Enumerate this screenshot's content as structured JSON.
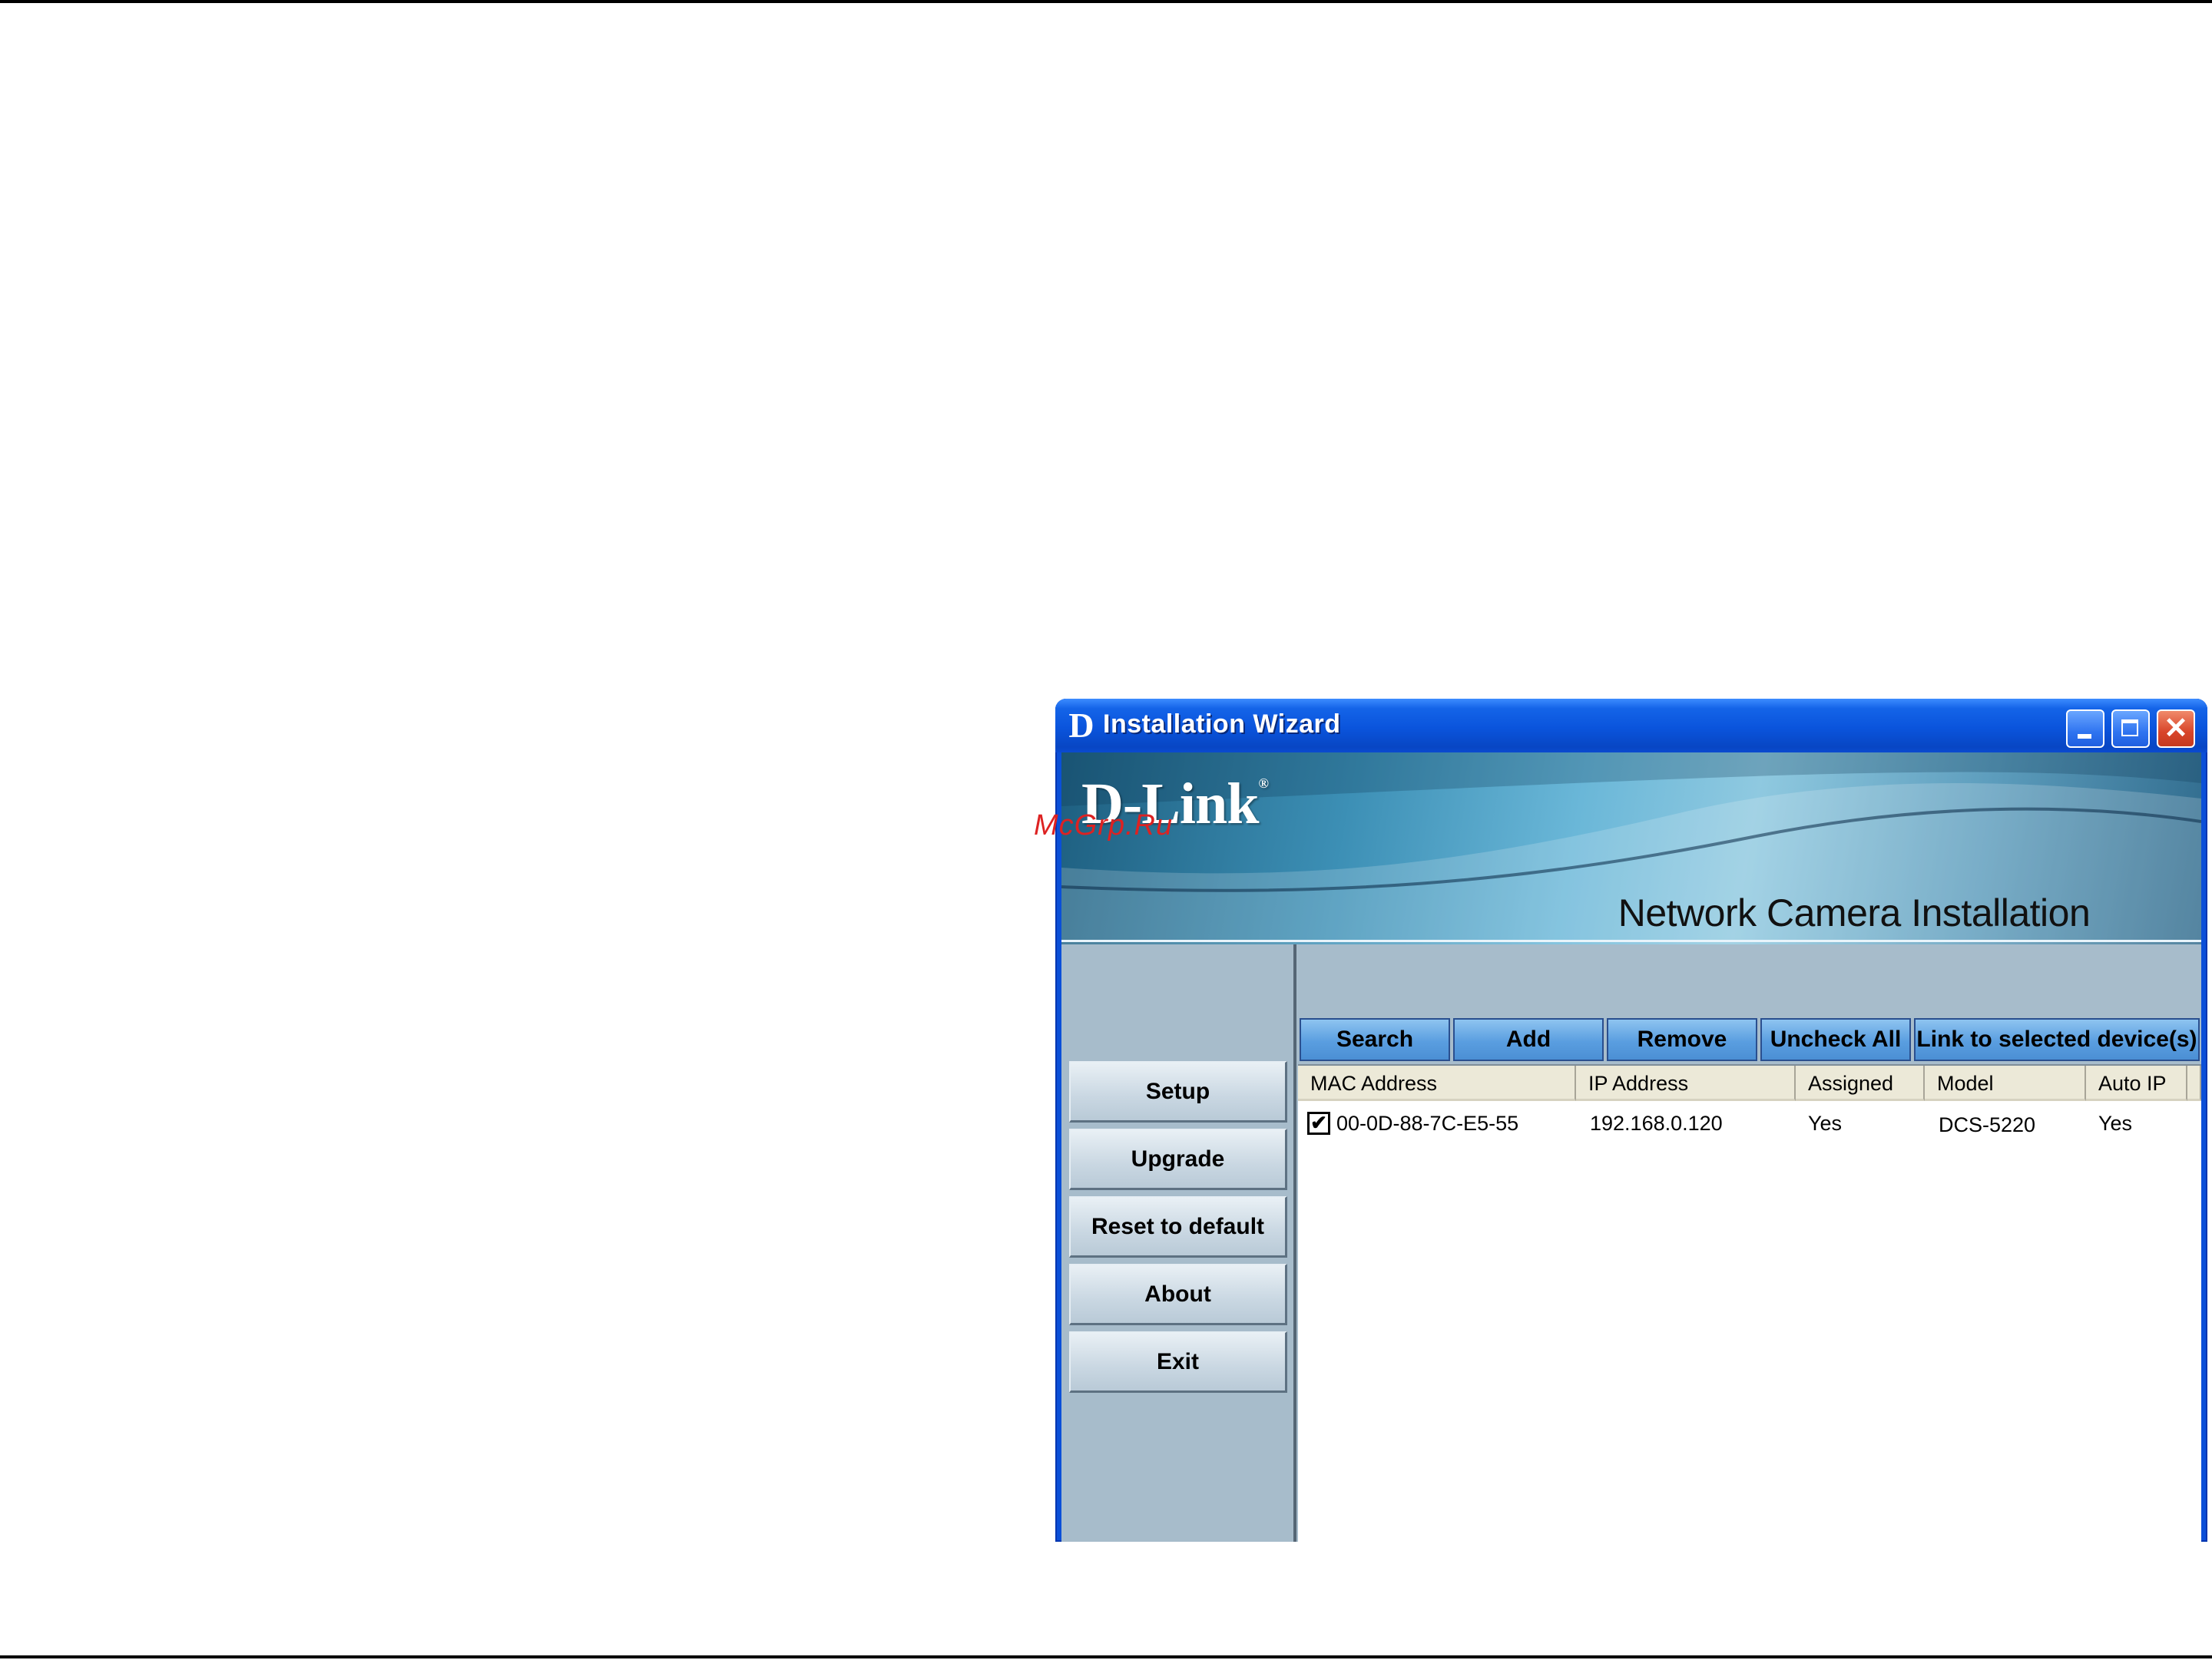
{
  "window": {
    "title": "Installation Wizard",
    "title_icon": "D",
    "controls": {
      "minimize_icon": "minimize-icon",
      "maximize_icon": "maximize-icon",
      "close_icon": "close-icon",
      "close_glyph": "✕"
    }
  },
  "banner": {
    "brand": "D-Link",
    "title": "Network Camera Installation"
  },
  "watermark": "McGrp.Ru",
  "sidebar": {
    "items": [
      {
        "label": "Setup"
      },
      {
        "label": "Upgrade"
      },
      {
        "label": "Reset to default"
      },
      {
        "label": "About"
      },
      {
        "label": "Exit"
      }
    ]
  },
  "toolbar": {
    "buttons": [
      {
        "label": "Search"
      },
      {
        "label": "Add"
      },
      {
        "label": "Remove"
      },
      {
        "label": "Uncheck All"
      },
      {
        "label": "Link to selected device(s)"
      }
    ]
  },
  "device_list": {
    "columns": [
      "MAC Address",
      "IP Address",
      "Assigned",
      "Model",
      "Auto IP"
    ],
    "rows": [
      {
        "checked": true,
        "check_glyph": "✔",
        "mac": "00-0D-88-7C-E5-55",
        "ip": "192.168.0.120",
        "assigned": "Yes",
        "model": "DCS-5220",
        "auto_ip": "Yes"
      }
    ]
  },
  "colors": {
    "titlebar": "#0a54dc",
    "client_bg": "#a7bccb",
    "toolbar_button": "#5a9ee0",
    "close_button": "#d8452a"
  }
}
